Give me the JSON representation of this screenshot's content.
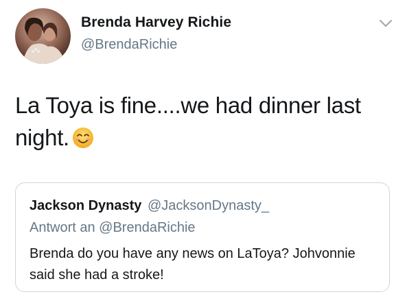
{
  "tweet": {
    "author": {
      "display_name": "Brenda Harvey Richie",
      "handle": "@BrendaRichie"
    },
    "text": "La Toya is fine....we had dinner last night.",
    "emoji": "smiling-face-icon",
    "menu_icon": "chevron-down-icon"
  },
  "quoted_tweet": {
    "display_name": "Jackson Dynasty",
    "handle": "@JacksonDynasty_",
    "reply_context": "Antwort an @BrendaRichie",
    "text": "Brenda do you have any news on LaToya? Johvonnie said she had a stroke!"
  },
  "colors": {
    "text_primary": "#14171a",
    "text_secondary": "#657786",
    "border": "#ccd6dd",
    "emoji_yellow": "#f7c23b"
  }
}
